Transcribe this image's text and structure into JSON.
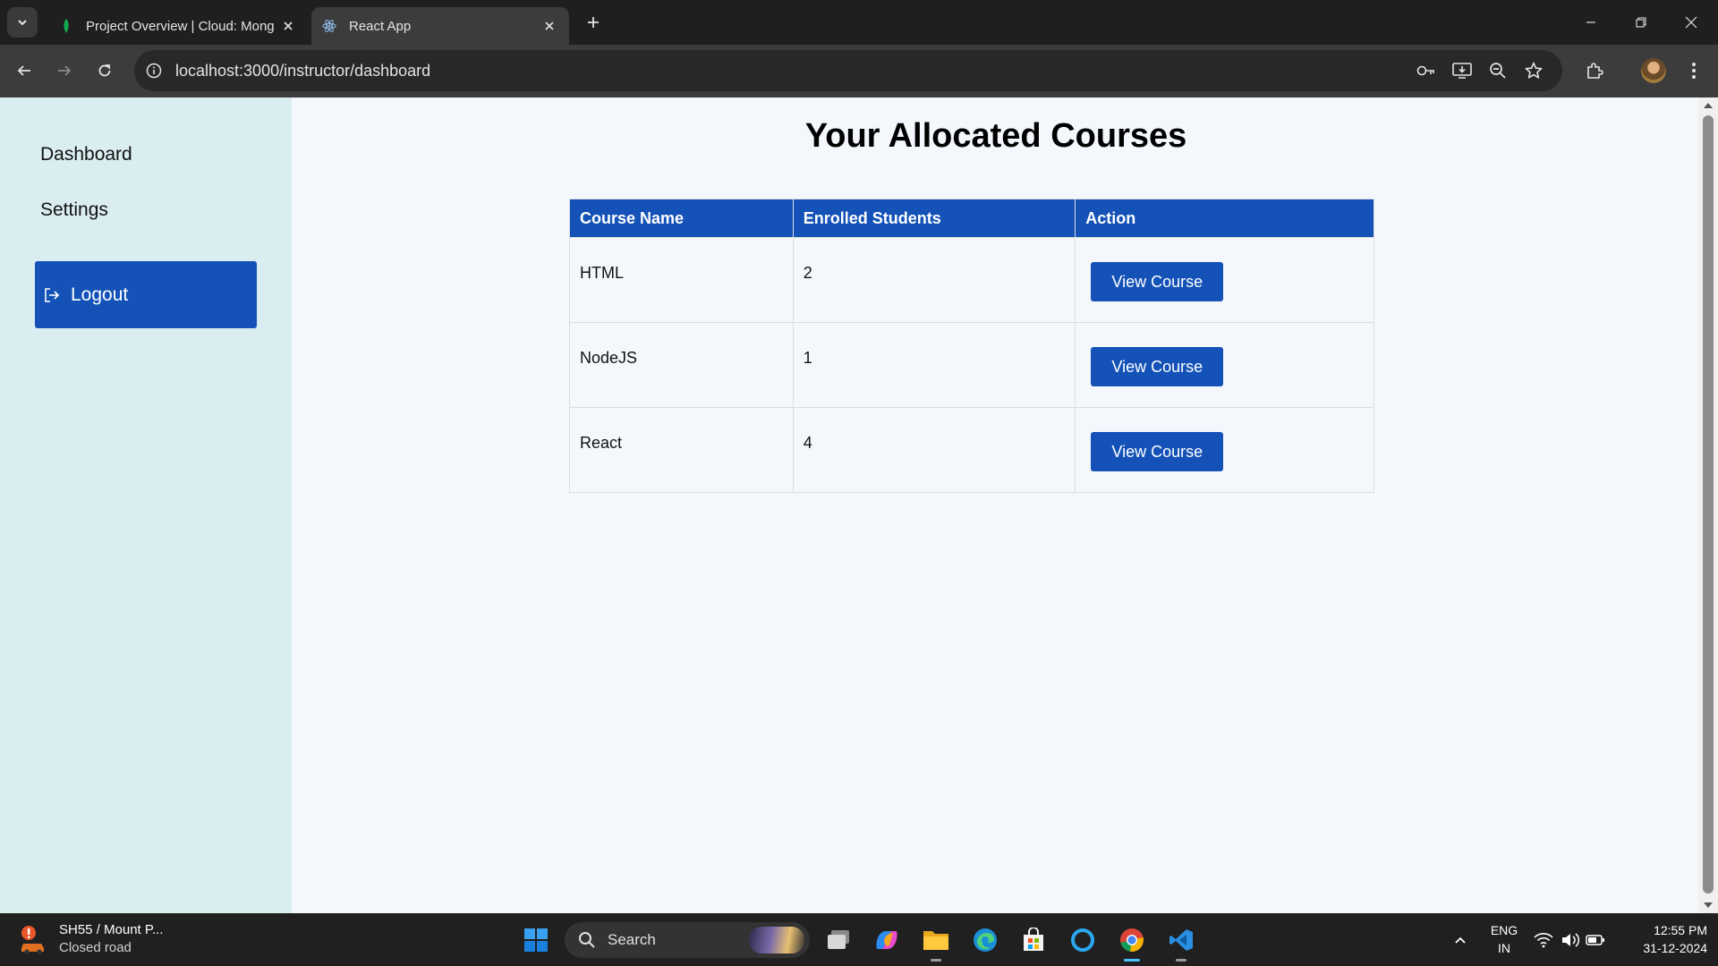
{
  "browser": {
    "tabs": [
      {
        "title": "Project Overview | Cloud: Mong",
        "favicon": "mongodb-leaf-icon",
        "active": false
      },
      {
        "title": "React App",
        "favicon": "react-atom-icon",
        "active": true
      }
    ],
    "url": "localhost:3000/instructor/dashboard"
  },
  "sidebar": {
    "items": [
      {
        "label": "Dashboard"
      },
      {
        "label": "Settings"
      }
    ],
    "logout_label": "Logout"
  },
  "main": {
    "title": "Your Allocated Courses",
    "table": {
      "headers": [
        "Course Name",
        "Enrolled Students",
        "Action"
      ],
      "rows": [
        {
          "course": "HTML",
          "students": "2",
          "action": "View Course"
        },
        {
          "course": "NodeJS",
          "students": "1",
          "action": "View Course"
        },
        {
          "course": "React",
          "students": "4",
          "action": "View Course"
        }
      ]
    }
  },
  "taskbar": {
    "weather_title": "SH55 / Mount P...",
    "weather_sub": "Closed road",
    "search_label": "Search",
    "lang_line1": "ENG",
    "lang_line2": "IN",
    "time": "12:55 PM",
    "date": "31-12-2024"
  },
  "colors": {
    "accent": "#1452b8",
    "sidebar_bg": "#daeef2",
    "page_bg": "#f4f8fd"
  }
}
